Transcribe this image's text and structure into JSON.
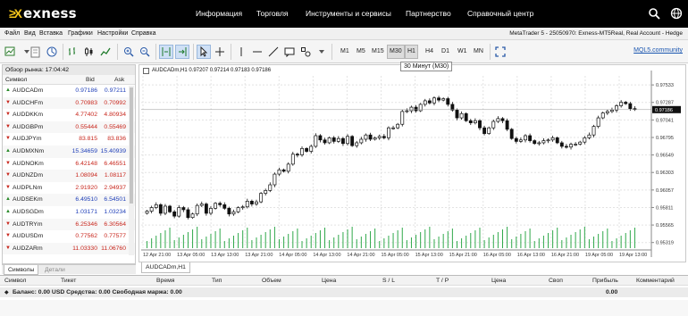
{
  "brand": {
    "name": "exness",
    "mark": "≥X"
  },
  "topnav": [
    "Информация",
    "Торговля",
    "Инструменты и сервисы",
    "Партнерство",
    "Справочный центр"
  ],
  "menu": [
    "Файл",
    "Вид",
    "Вставка",
    "Графики",
    "Настройки",
    "Справка"
  ],
  "account_info": "MetaTrader 5 - 25050970: Exness-MT5Real, Real Account - Hedge",
  "timeframes": [
    "M1",
    "M5",
    "M15",
    "M30",
    "H1",
    "H4",
    "D1",
    "W1",
    "MN"
  ],
  "active_timeframe": "M30",
  "tooltip": "30 Минут (M30)",
  "mql_link": "MQL5.community",
  "market_watch": {
    "title": "Обзор рынка: 17:04:42",
    "col_symbol": "Символ",
    "col_bid": "Bid",
    "col_ask": "Ask",
    "rows": [
      {
        "symbol": "AUDCADm",
        "bid": "0.97186",
        "ask": "0.97211",
        "dir": "up",
        "color": "#1f3fb8"
      },
      {
        "symbol": "AUDCHFm",
        "bid": "0.70983",
        "ask": "0.70992",
        "dir": "down",
        "color": "#c8261c"
      },
      {
        "symbol": "AUDDKKm",
        "bid": "4.77402",
        "ask": "4.80934",
        "dir": "down",
        "color": "#c8261c"
      },
      {
        "symbol": "AUDGBPm",
        "bid": "0.55444",
        "ask": "0.55469",
        "dir": "down",
        "color": "#c8261c"
      },
      {
        "symbol": "AUDJPYm",
        "bid": "83.815",
        "ask": "83.836",
        "dir": "down",
        "color": "#c8261c"
      },
      {
        "symbol": "AUDMXNm",
        "bid": "15.34659",
        "ask": "15.40939",
        "dir": "up",
        "color": "#1f3fb8"
      },
      {
        "symbol": "AUDNOKm",
        "bid": "6.42148",
        "ask": "6.46551",
        "dir": "down",
        "color": "#c8261c"
      },
      {
        "symbol": "AUDNZDm",
        "bid": "1.08094",
        "ask": "1.08117",
        "dir": "down",
        "color": "#c8261c"
      },
      {
        "symbol": "AUDPLNm",
        "bid": "2.91920",
        "ask": "2.94937",
        "dir": "down",
        "color": "#c8261c"
      },
      {
        "symbol": "AUDSEKm",
        "bid": "6.49510",
        "ask": "6.54501",
        "dir": "up",
        "color": "#1f3fb8"
      },
      {
        "symbol": "AUDSGDm",
        "bid": "1.03171",
        "ask": "1.03234",
        "dir": "up",
        "color": "#1f3fb8"
      },
      {
        "symbol": "AUDTRYm",
        "bid": "6.25346",
        "ask": "6.30564",
        "dir": "down",
        "color": "#c8261c"
      },
      {
        "symbol": "AUDUSDm",
        "bid": "0.77562",
        "ask": "0.77577",
        "dir": "down",
        "color": "#c8261c"
      },
      {
        "symbol": "AUDZARm",
        "bid": "11.03330",
        "ask": "11.06760",
        "dir": "down",
        "color": "#c8261c"
      }
    ],
    "tabs": [
      "Символы",
      "Детали"
    ]
  },
  "chart": {
    "header": "AUDCADm,H1  0.97207 0.97214 0.97183 0.97186",
    "tab_label": "AUDCADm,H1",
    "current_price": "0.97186"
  },
  "chart_data": {
    "type": "candlestick",
    "symbol": "AUDCADm",
    "timeframe": "H1",
    "y_ticks": [
      "0.97533",
      "0.97287",
      "0.97041",
      "0.96795",
      "0.96549",
      "0.96303",
      "0.96057",
      "0.95811",
      "0.95565",
      "0.95319"
    ],
    "ylim": [
      0.9524,
      0.9766
    ],
    "x_ticks": [
      "12 Apr 21:00",
      "13 Apr 05:00",
      "13 Apr 13:00",
      "13 Apr 21:00",
      "14 Apr 05:00",
      "14 Apr 13:00",
      "14 Apr 21:00",
      "15 Apr 05:00",
      "15 Apr 13:00",
      "15 Apr 21:00",
      "16 Apr 05:00",
      "16 Apr 13:00",
      "16 Apr 21:00",
      "19 Apr 05:00",
      "19 Apr 13:00"
    ],
    "close": [
      0.9576,
      0.9581,
      0.9585,
      0.9573,
      0.9583,
      0.9575,
      0.9569,
      0.9581,
      0.9578,
      0.9567,
      0.9572,
      0.9584,
      0.9586,
      0.9573,
      0.958,
      0.9587,
      0.9585,
      0.958,
      0.9572,
      0.9575,
      0.9581,
      0.9582,
      0.959,
      0.9586,
      0.9589,
      0.9601,
      0.9605,
      0.9613,
      0.9628,
      0.9634,
      0.9632,
      0.9642,
      0.9656,
      0.9655,
      0.9664,
      0.966,
      0.9667,
      0.9682,
      0.9676,
      0.9672,
      0.9679,
      0.9674,
      0.9678,
      0.9671,
      0.9681,
      0.9668,
      0.9672,
      0.9677,
      0.9683,
      0.9677,
      0.9679,
      0.9681,
      0.9679,
      0.9693,
      0.9693,
      0.9698,
      0.9716,
      0.9717,
      0.9722,
      0.9717,
      0.9726,
      0.9731,
      0.9728,
      0.9735,
      0.9732,
      0.9734,
      0.9726,
      0.9718,
      0.9707,
      0.9713,
      0.9703,
      0.97,
      0.9703,
      0.9693,
      0.9685,
      0.9693,
      0.9702,
      0.9706,
      0.9703,
      0.9691,
      0.9678,
      0.9674,
      0.9676,
      0.9682,
      0.9675,
      0.9671,
      0.9672,
      0.9675,
      0.9676,
      0.9679,
      0.9672,
      0.9667,
      0.9666,
      0.967,
      0.967,
      0.9673,
      0.9679,
      0.9683,
      0.9695,
      0.9707,
      0.9714,
      0.9716,
      0.9718,
      0.9724,
      0.9729,
      0.9727,
      0.972,
      0.9719
    ],
    "dates_shown": "12 Apr – 19 Apr"
  },
  "terminal": {
    "columns": [
      "Символ",
      "Тикет",
      "Время",
      "Тип",
      "Объем",
      "Цена",
      "S / L",
      "T / P",
      "Цена",
      "Своп",
      "Прибыль",
      "Комментарий"
    ],
    "balance_line": "Баланс: 0.00 USD  Средства: 0.00  Свободная маржа: 0.00",
    "profit_total": "0.00"
  }
}
